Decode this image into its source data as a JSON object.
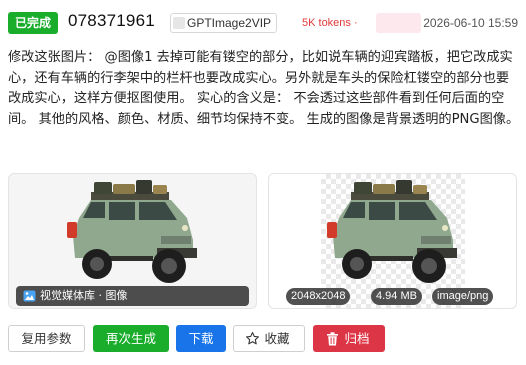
{
  "header": {
    "status": "已完成",
    "task_id": "078371961",
    "model": "GPTImage2VIP",
    "tokens": "5K tokens ·",
    "timestamp": "2026-06-10 15:59"
  },
  "prompt": "修改这张图片： @图像1 去掉可能有镂空的部分，比如说车辆的迎宾踏板，把它改成实心，还有车辆的行李架中的栏杆也要改成实心。另外就是车头的保险杠镂空的部分也要改成实心，这样方便抠图使用。 实心的含义是： 不会透过这些部件看到任何后面的空间。 其他的风格、颜色、材质、细节均保持不变。 生成的图像是背景透明的PNG图像。",
  "source_image": {
    "label": "视觉媒体库 · 图像",
    "icon": "image-icon"
  },
  "result_image": {
    "dimensions": "2048x2048",
    "size": "4.94 MB",
    "format": "image/png"
  },
  "actions": {
    "reuse": "复用参数",
    "regenerate": "再次生成",
    "download": "下载",
    "favorite": "收藏",
    "archive": "归档"
  },
  "colors": {
    "success": "#1aad2c",
    "primary": "#1874e8",
    "danger": "#dc3545",
    "tokens": "#e23b3b"
  }
}
